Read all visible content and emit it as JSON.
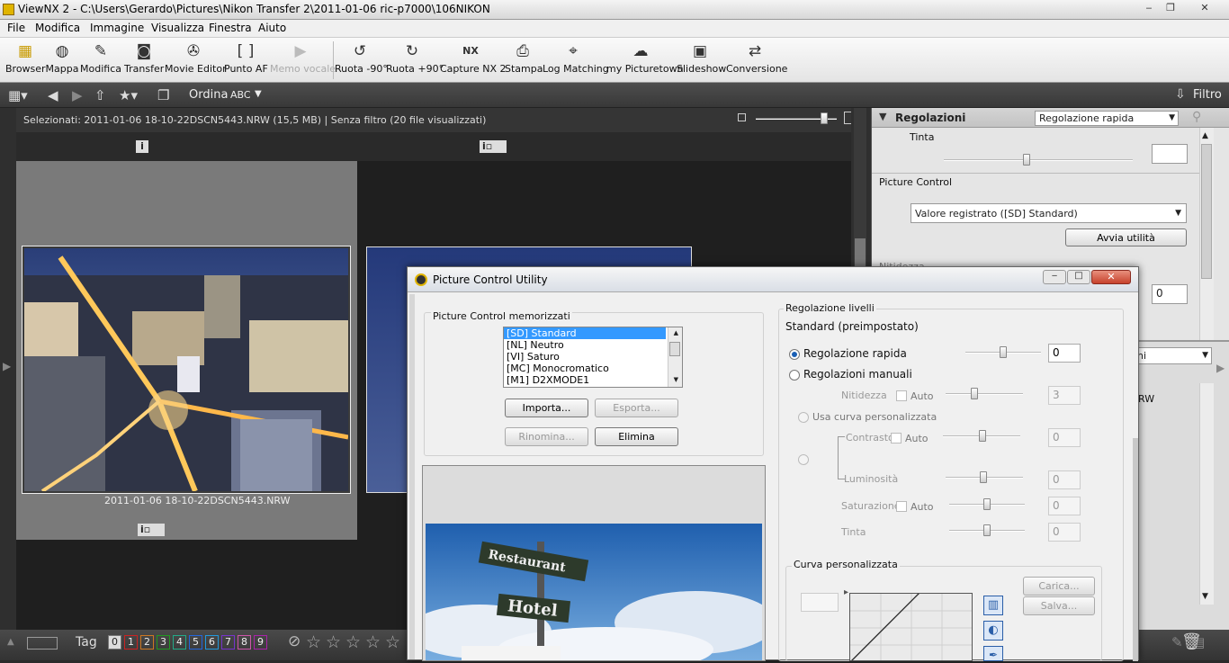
{
  "window": {
    "title": "ViewNX 2 - C:\\Users\\Gerardo\\Pictures\\Nikon Transfer 2\\2011-01-06 ric-p7000\\106NIKON",
    "minimize": "‒",
    "maximize": "❐",
    "close": "✕"
  },
  "menu": [
    "File",
    "Modifica",
    "Immagine",
    "Visualizza",
    "Finestra",
    "Aiuto"
  ],
  "toolbar": {
    "items": [
      "Browser",
      "Mappa",
      "Modifica",
      "Transfer",
      "Movie Editor",
      "Punto AF",
      "Memo vocale",
      "Ruota -90°",
      "Ruota +90°",
      "Capture NX 2",
      "Stampa",
      "Log Matching",
      "my Picturetown",
      "Slideshow",
      "Conversione"
    ]
  },
  "toolbar2": {
    "sort_label": "Ordina",
    "sort_value": "ABC",
    "filter_label": "Filtro"
  },
  "status": {
    "selected": "Selezionati: 2011-01-06 18-10-22DSCN5443.NRW (15,5 MB) | Senza filtro  (20 file visualizzati)"
  },
  "thumbnails": [
    {
      "filename": "2011-01-06 18-10-22DSCN5443.NRW"
    }
  ],
  "panel": {
    "title": "Regolazioni",
    "dropdown": "Regolazione rapida",
    "tinta_label": "Tinta",
    "picture_control_label": "Picture Control",
    "picture_control_value": "Valore registrato ([SD] Standard)",
    "launch_button": "Avvia utilità",
    "nitidezza_label": "Nitidezza",
    "nitidezza_value": "0",
    "lower_dropdown": "ni",
    "lower_file": "RW"
  },
  "bottombar": {
    "tag_label": "Tag",
    "tags": [
      "0",
      "1",
      "2",
      "3",
      "4",
      "5",
      "6",
      "7",
      "8",
      "9"
    ],
    "tag_colors": [
      "#777777",
      "#cc2222",
      "#cc7722",
      "#229922",
      "#22aa88",
      "#2266dd",
      "#2299dd",
      "#7733cc",
      "#cc55aa",
      "#aa22aa"
    ],
    "stars": [
      "☆",
      "☆",
      "☆",
      "☆",
      "☆"
    ]
  },
  "dialog": {
    "title": "Picture Control Utility",
    "stored_group": "Picture Control memorizzati",
    "list": [
      "[SD] Standard",
      "[NL] Neutro",
      "[VI] Saturo",
      "[MC] Monocromatico",
      "[M1] D2XMODE1"
    ],
    "selected_index": 0,
    "import_button": "Importa...",
    "export_button": "Esporta...",
    "rename_button": "Rinomina...",
    "delete_button": "Elimina",
    "levels_group": "Regolazione livelli",
    "preset_name": "Standard (preimpostato)",
    "quick_adjust_label": "Regolazione rapida",
    "quick_adjust_value": "0",
    "manual_label": "Regolazioni manuali",
    "sharpness_label": "Nitidezza",
    "auto_label": "Auto",
    "sharpness_value": "3",
    "custom_curve_option": "Usa curva personalizzata",
    "contrast_label": "Contrasto",
    "contrast_value": "0",
    "brightness_label": "Luminosità",
    "brightness_value": "0",
    "saturation_label": "Saturazione",
    "saturation_value": "0",
    "hue_label": "Tinta",
    "hue_value": "0",
    "curve_group": "Curva personalizzata",
    "load_button": "Carica...",
    "save_button": "Salva...",
    "sign_top": "Restaurant",
    "sign_bottom": "Hotel"
  },
  "colors": {
    "selection": "#3399ff",
    "panel_bg": "#e5e5e5",
    "dark_bg": "#1f1f1f"
  }
}
